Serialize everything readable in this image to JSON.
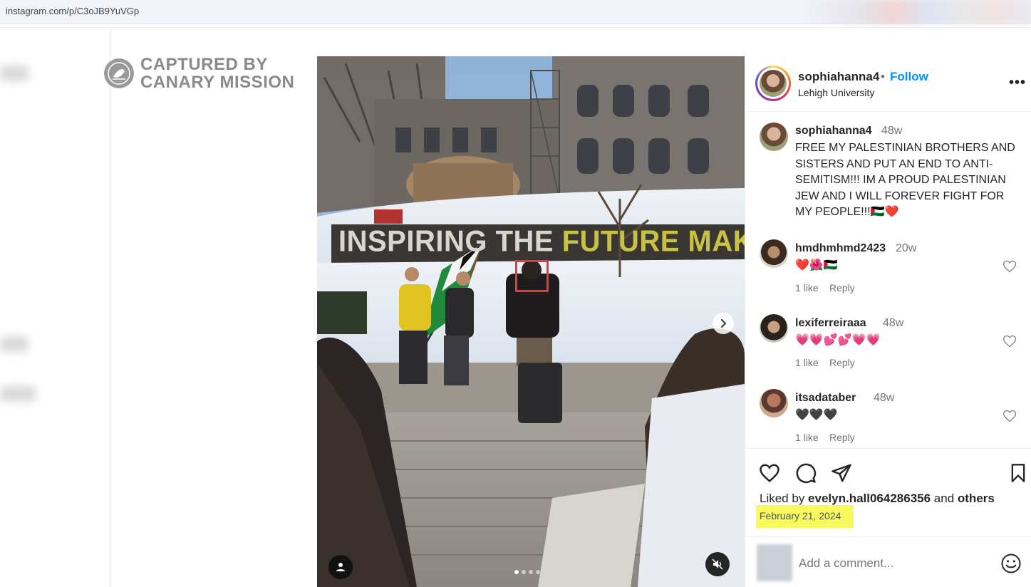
{
  "browser": {
    "url": "instagram.com/p/C3oJB9YuVGp"
  },
  "watermark": {
    "text": "CAPTURED BY\nCANARY MISSION"
  },
  "photo": {
    "banner_part1": "INSPIRING THE ",
    "banner_part2": "FUTURE",
    "banner_part3": " MAKERS",
    "carousel_dots": 4,
    "active_dot": 0
  },
  "post": {
    "username": "sophiahanna4",
    "separator": "•",
    "follow_label": "Follow",
    "location": "Lehigh University",
    "more_label": "•••",
    "caption": {
      "username": "sophiahanna4",
      "time": "48w",
      "text": "FREE MY PALESTINIAN BROTHERS AND SISTERS AND PUT AN END TO ANTI-SEMITISM!!! IM A PROUD PALESTINIAN JEW AND I WILL FOREVER FIGHT FOR MY PEOPLE!!!🇵🇸❤️"
    },
    "comments": [
      {
        "username": "hmdhmhmd2423",
        "time": "20w",
        "text": "❤️🌺🇵🇸",
        "likes": "1 like",
        "reply": "Reply"
      },
      {
        "username": "lexiferreiraaa",
        "time": "48w",
        "text": "💗💗💕💕💗💗",
        "likes": "1 like",
        "reply": "Reply"
      },
      {
        "username": "itsadataber",
        "time": "48w",
        "text": "🖤🖤🖤",
        "likes": "1 like",
        "reply": "Reply"
      }
    ],
    "liked_prefix": "Liked by ",
    "liked_user": "evelyn.hall064286356",
    "liked_mid": " and ",
    "liked_others": "others",
    "date": "February 21, 2024",
    "comment_placeholder": "Add a comment..."
  },
  "colors": {
    "follow": "#0095f6",
    "highlight_box": "#e8383d",
    "date_highlight": "#f7f95c"
  }
}
